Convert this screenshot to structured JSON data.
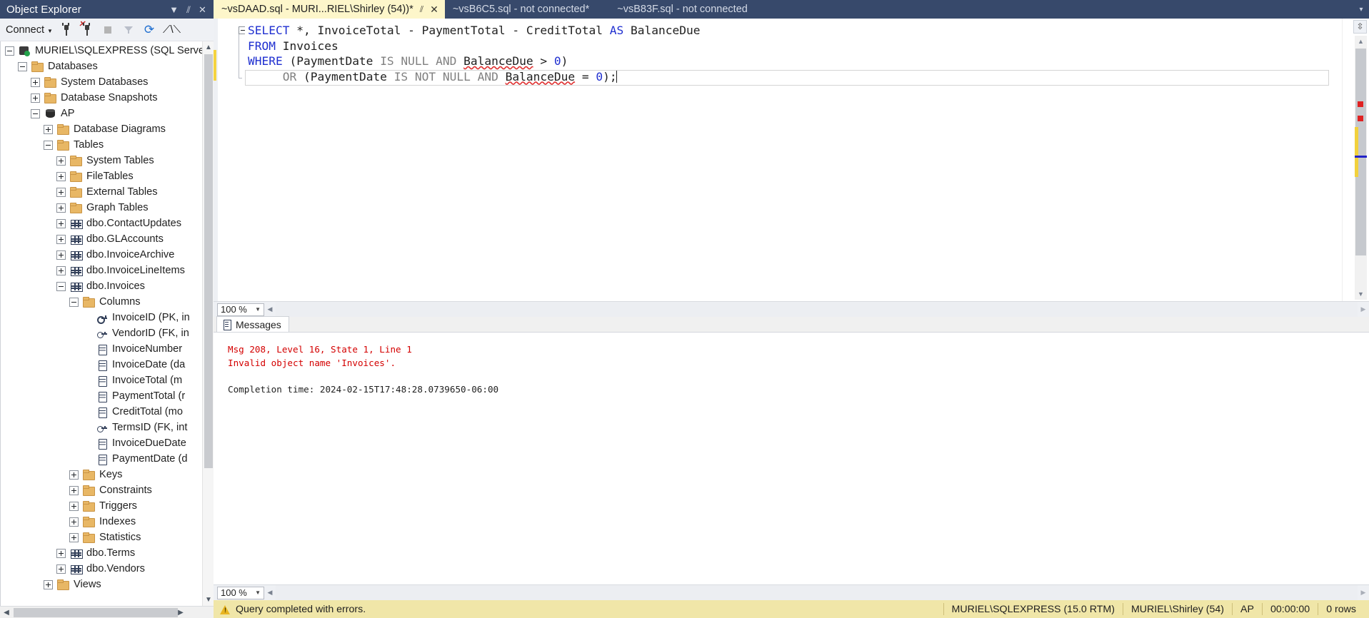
{
  "object_explorer": {
    "title": "Object Explorer",
    "title_buttons": [
      {
        "name": "dropdown",
        "glyph": "▼"
      },
      {
        "name": "pin",
        "glyph": "⫽"
      },
      {
        "name": "close",
        "glyph": "✕"
      }
    ],
    "toolbar": {
      "connect_label": "Connect",
      "connect_arrow": "▼",
      "icons": [
        "connect-plug-icon",
        "disconnect-plug-icon",
        "stop-icon",
        "filter-icon",
        "refresh-icon",
        "activity-monitor-icon"
      ]
    },
    "tree": [
      {
        "label": "MURIEL\\SQLEXPRESS (SQL Server",
        "indent": 0,
        "expander": "minus",
        "icon": "server"
      },
      {
        "label": "Databases",
        "indent": 1,
        "expander": "minus",
        "icon": "folder"
      },
      {
        "label": "System Databases",
        "indent": 2,
        "expander": "plus",
        "icon": "folder"
      },
      {
        "label": "Database Snapshots",
        "indent": 2,
        "expander": "plus",
        "icon": "folder"
      },
      {
        "label": "AP",
        "indent": 2,
        "expander": "minus",
        "icon": "db"
      },
      {
        "label": "Database Diagrams",
        "indent": 3,
        "expander": "plus",
        "icon": "folder"
      },
      {
        "label": "Tables",
        "indent": 3,
        "expander": "minus",
        "icon": "folder"
      },
      {
        "label": "System Tables",
        "indent": 4,
        "expander": "plus",
        "icon": "folder"
      },
      {
        "label": "FileTables",
        "indent": 4,
        "expander": "plus",
        "icon": "folder"
      },
      {
        "label": "External Tables",
        "indent": 4,
        "expander": "plus",
        "icon": "folder"
      },
      {
        "label": "Graph Tables",
        "indent": 4,
        "expander": "plus",
        "icon": "folder"
      },
      {
        "label": "dbo.ContactUpdates",
        "indent": 4,
        "expander": "plus",
        "icon": "table"
      },
      {
        "label": "dbo.GLAccounts",
        "indent": 4,
        "expander": "plus",
        "icon": "table"
      },
      {
        "label": "dbo.InvoiceArchive",
        "indent": 4,
        "expander": "plus",
        "icon": "table"
      },
      {
        "label": "dbo.InvoiceLineItems",
        "indent": 4,
        "expander": "plus",
        "icon": "table"
      },
      {
        "label": "dbo.Invoices",
        "indent": 4,
        "expander": "minus",
        "icon": "table"
      },
      {
        "label": "Columns",
        "indent": 5,
        "expander": "minus",
        "icon": "folder"
      },
      {
        "label": "InvoiceID (PK, in",
        "indent": 6,
        "expander": "none",
        "icon": "pk"
      },
      {
        "label": "VendorID (FK, in",
        "indent": 6,
        "expander": "none",
        "icon": "fk"
      },
      {
        "label": "InvoiceNumber",
        "indent": 6,
        "expander": "none",
        "icon": "col"
      },
      {
        "label": "InvoiceDate (da",
        "indent": 6,
        "expander": "none",
        "icon": "col"
      },
      {
        "label": "InvoiceTotal (m",
        "indent": 6,
        "expander": "none",
        "icon": "col"
      },
      {
        "label": "PaymentTotal (r",
        "indent": 6,
        "expander": "none",
        "icon": "col"
      },
      {
        "label": "CreditTotal (mo",
        "indent": 6,
        "expander": "none",
        "icon": "col"
      },
      {
        "label": "TermsID (FK, int",
        "indent": 6,
        "expander": "none",
        "icon": "fk"
      },
      {
        "label": "InvoiceDueDate",
        "indent": 6,
        "expander": "none",
        "icon": "col"
      },
      {
        "label": "PaymentDate (d",
        "indent": 6,
        "expander": "none",
        "icon": "col"
      },
      {
        "label": "Keys",
        "indent": 5,
        "expander": "plus",
        "icon": "folder"
      },
      {
        "label": "Constraints",
        "indent": 5,
        "expander": "plus",
        "icon": "folder"
      },
      {
        "label": "Triggers",
        "indent": 5,
        "expander": "plus",
        "icon": "folder"
      },
      {
        "label": "Indexes",
        "indent": 5,
        "expander": "plus",
        "icon": "folder"
      },
      {
        "label": "Statistics",
        "indent": 5,
        "expander": "plus",
        "icon": "folder"
      },
      {
        "label": "dbo.Terms",
        "indent": 4,
        "expander": "plus",
        "icon": "table"
      },
      {
        "label": "dbo.Vendors",
        "indent": 4,
        "expander": "plus",
        "icon": "table"
      },
      {
        "label": "Views",
        "indent": 3,
        "expander": "plus",
        "icon": "folder"
      }
    ]
  },
  "tabs": [
    {
      "label": "~vsDAAD.sql - MURI...RIEL\\Shirley (54))*",
      "active": true,
      "pin": "⫽",
      "close": "✕"
    },
    {
      "label": "~vsB6C5.sql - not connected*",
      "active": false
    },
    {
      "label": "~vsB83F.sql - not connected",
      "active": false
    }
  ],
  "tabstrip_chevron": "▾",
  "editor": {
    "zoom_level": "100 %",
    "zoom_arrow": "▼",
    "code_lines": [
      {
        "segments": [
          {
            "text": "SELECT",
            "style": "kw"
          },
          {
            "text": " *, InvoiceTotal - PaymentTotal - CreditTotal ",
            "style": "plain"
          },
          {
            "text": "AS",
            "style": "kw"
          },
          {
            "text": " BalanceDue",
            "style": "plain"
          }
        ]
      },
      {
        "segments": [
          {
            "text": "FROM",
            "style": "kw"
          },
          {
            "text": " Invoices",
            "style": "plain"
          }
        ]
      },
      {
        "segments": [
          {
            "text": "WHERE",
            "style": "kw"
          },
          {
            "text": " (PaymentDate ",
            "style": "plain"
          },
          {
            "text": "IS NULL AND",
            "style": "gray"
          },
          {
            "text": " ",
            "style": "plain"
          },
          {
            "text": "BalanceDue",
            "style": "squig"
          },
          {
            "text": " > ",
            "style": "plain"
          },
          {
            "text": "0",
            "style": "num"
          },
          {
            "text": ")",
            "style": "plain"
          }
        ]
      },
      {
        "segments": [
          {
            "text": "     ",
            "style": "plain"
          },
          {
            "text": "OR",
            "style": "gray"
          },
          {
            "text": " (PaymentDate ",
            "style": "plain"
          },
          {
            "text": "IS NOT NULL AND",
            "style": "gray"
          },
          {
            "text": " ",
            "style": "plain"
          },
          {
            "text": "BalanceDue",
            "style": "squig"
          },
          {
            "text": " = ",
            "style": "plain"
          },
          {
            "text": "0",
            "style": "num"
          },
          {
            "text": ");",
            "style": "plain"
          }
        ]
      }
    ]
  },
  "results": {
    "zoom_level": "100 %",
    "zoom_arrow": "▼",
    "tab_label": "Messages",
    "messages": [
      {
        "text": "Msg 208, Level 16, State 1, Line 1",
        "kind": "error"
      },
      {
        "text": "Invalid object name 'Invoices'.",
        "kind": "error"
      },
      {
        "text": "",
        "kind": "gap"
      },
      {
        "text": "Completion time: 2024-02-15T17:48:28.0739650-06:00",
        "kind": "info"
      }
    ]
  },
  "statusbar": {
    "message": "Query completed with errors.",
    "cells": [
      "MURIEL\\SQLEXPRESS (15.0 RTM)",
      "MURIEL\\Shirley (54)",
      "AP",
      "00:00:00",
      "0 rows"
    ]
  },
  "colors": {
    "accent": "#37496b",
    "tab_active": "#fdf6ca",
    "status_bar": "#f0e6a8",
    "error_text": "#d40000",
    "keyword": "#1f2fd0"
  }
}
